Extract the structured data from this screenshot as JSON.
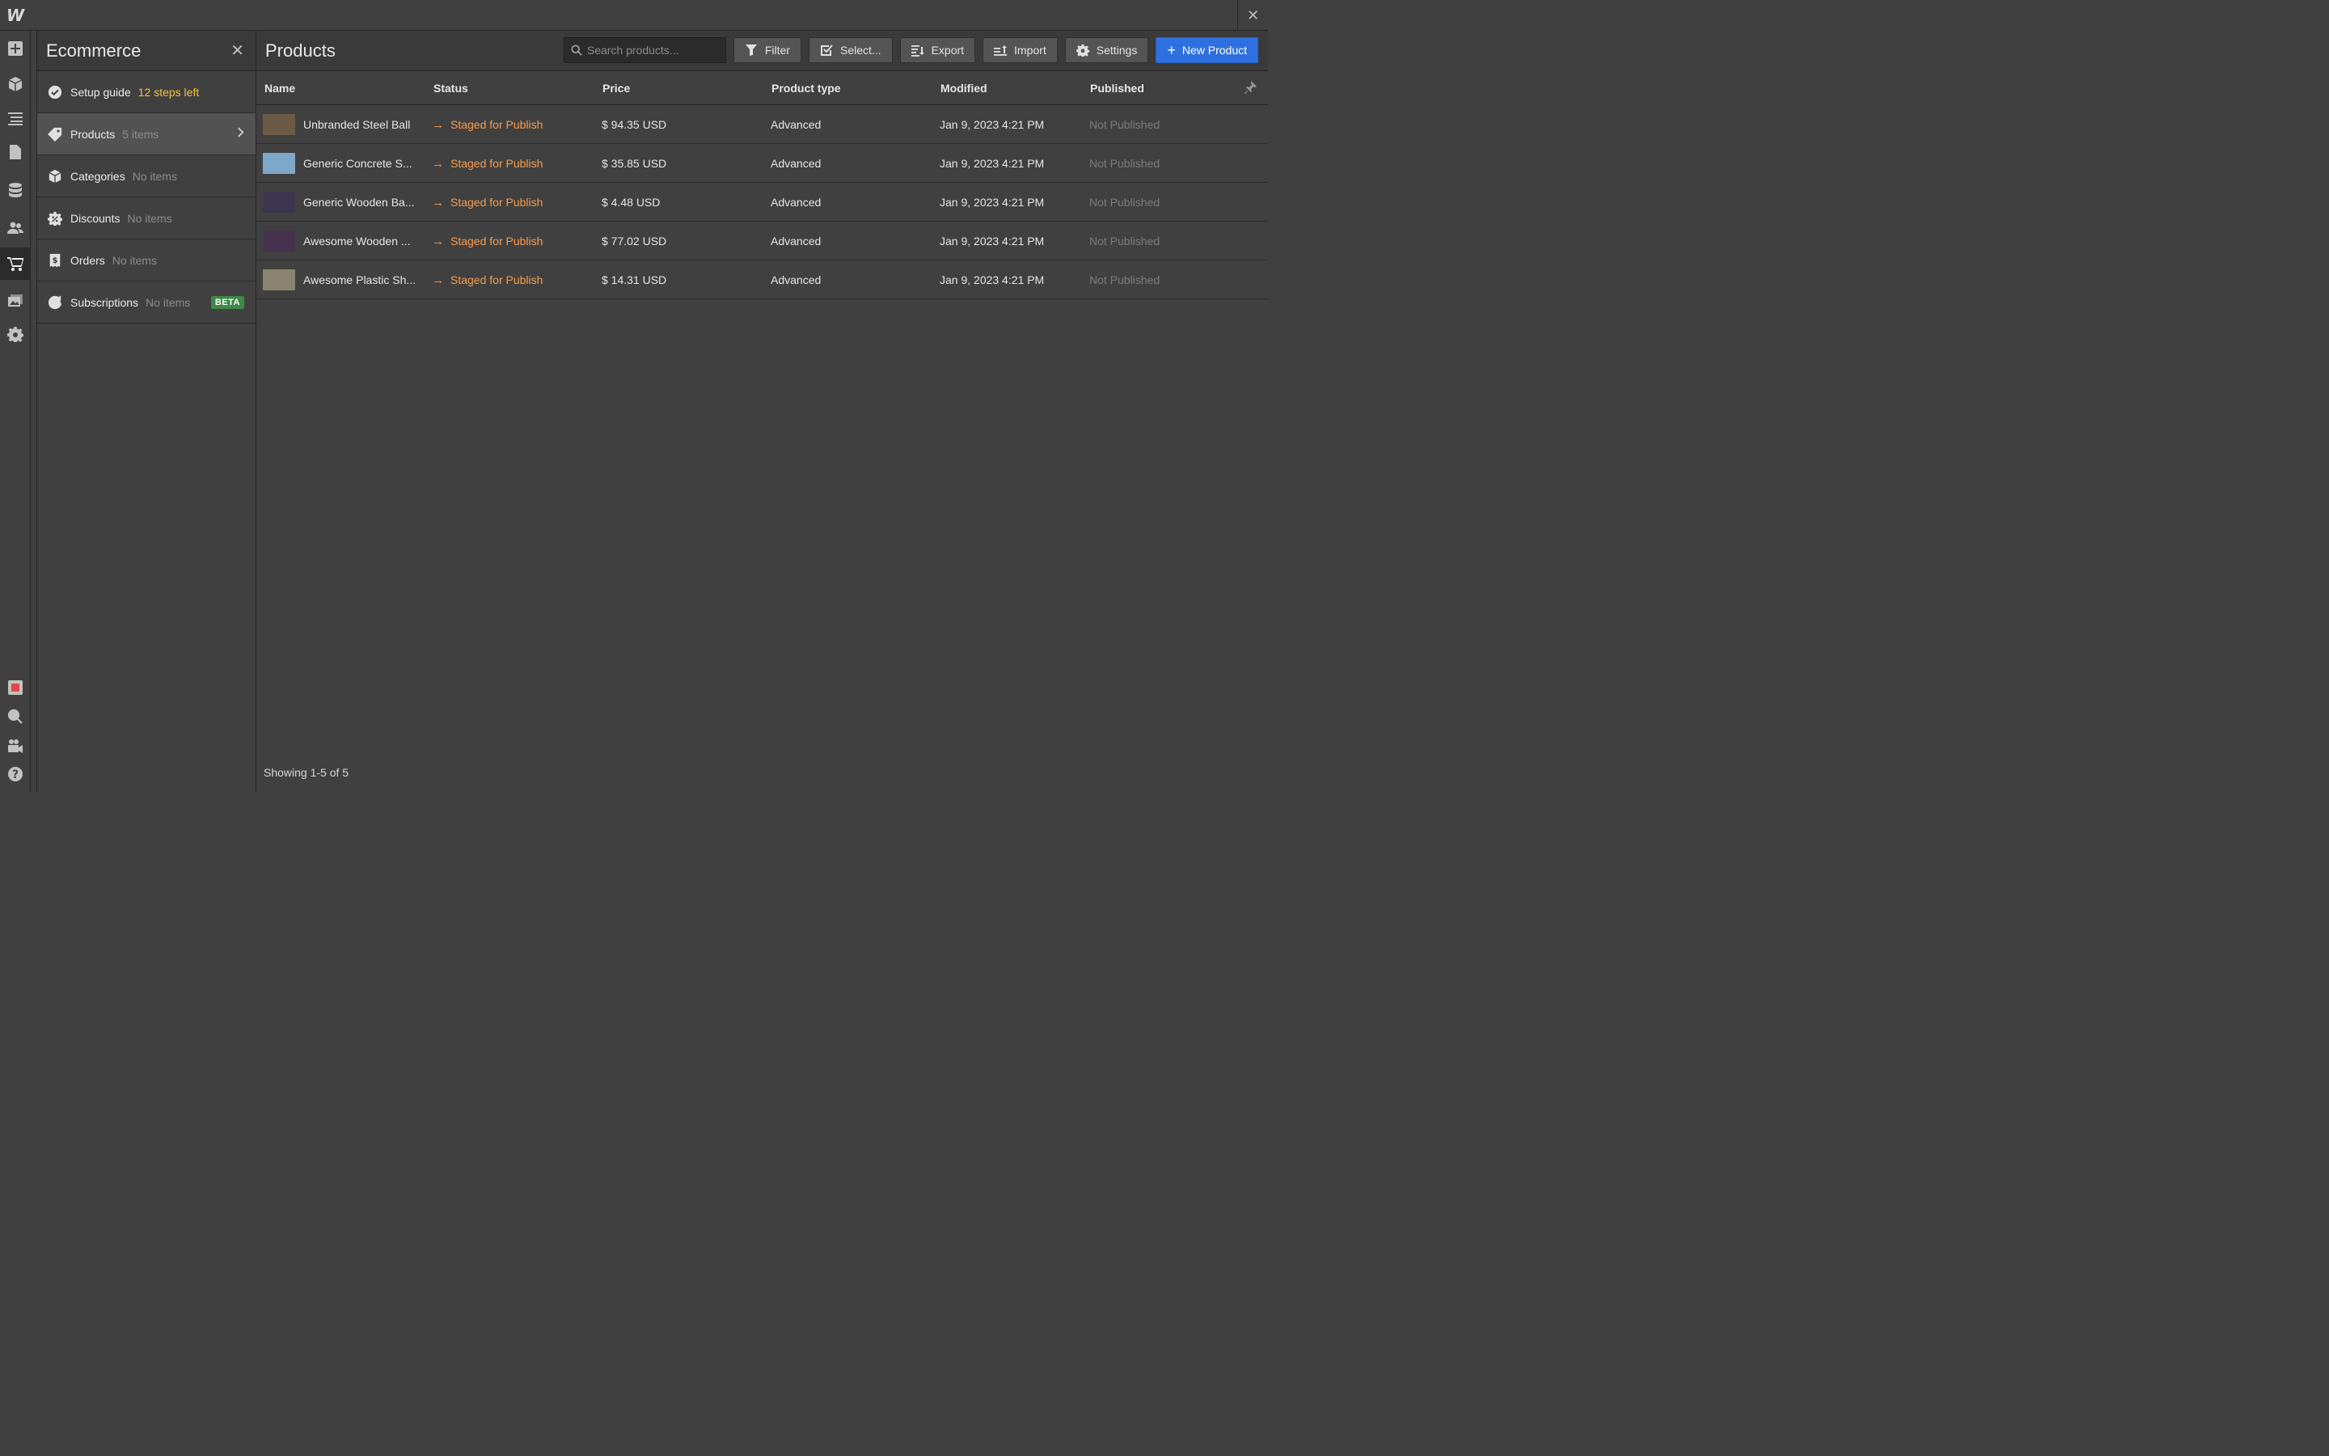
{
  "app": {
    "logo": "W",
    "close_symbol": "✕"
  },
  "rail": {
    "items": [
      {
        "name": "add-icon"
      },
      {
        "name": "box-icon"
      },
      {
        "name": "navigator-icon"
      },
      {
        "name": "pages-icon"
      },
      {
        "name": "cms-icon"
      },
      {
        "name": "users-icon"
      },
      {
        "name": "cart-icon"
      },
      {
        "name": "assets-icon"
      },
      {
        "name": "settings-icon"
      },
      {
        "name": "record-icon"
      },
      {
        "name": "search-icon"
      },
      {
        "name": "video-icon"
      },
      {
        "name": "help-icon"
      }
    ],
    "active": "cart-icon"
  },
  "panel": {
    "title": "Ecommerce",
    "items": [
      {
        "label": "Setup guide",
        "count": "12 steps left",
        "icon": "check-circle-icon"
      },
      {
        "label": "Products",
        "count": "5 items",
        "icon": "tag-icon"
      },
      {
        "label": "Categories",
        "count": "No items",
        "icon": "cube-icon"
      },
      {
        "label": "Discounts",
        "count": "No items",
        "icon": "discount-icon"
      },
      {
        "label": "Orders",
        "count": "No items",
        "icon": "dollar-icon"
      },
      {
        "label": "Subscriptions",
        "count": "No items",
        "icon": "subscription-icon",
        "badge": "BETA"
      }
    ]
  },
  "main": {
    "title": "Products",
    "search_placeholder": "Search products...",
    "toolbar": {
      "filter": "Filter",
      "select": "Select...",
      "export": "Export",
      "import": "Import",
      "settings": "Settings",
      "new_product": "New Product"
    },
    "columns": [
      "Name",
      "Status",
      "Price",
      "Product type",
      "Modified",
      "Published"
    ],
    "rows": [
      {
        "name": "Unbranded Steel Ball",
        "status": "Staged for Publish",
        "price": "$ 94.35 USD",
        "type": "Advanced",
        "modified": "Jan 9, 2023 4:21 PM",
        "published": "Not Published",
        "thumb": "#6b5a45"
      },
      {
        "name": "Generic Concrete S...",
        "status": "Staged for Publish",
        "price": "$ 35.85 USD",
        "type": "Advanced",
        "modified": "Jan 9, 2023 4:21 PM",
        "published": "Not Published",
        "thumb": "#7fa7c9"
      },
      {
        "name": "Generic Wooden Ba...",
        "status": "Staged for Publish",
        "price": "$ 4.48 USD",
        "type": "Advanced",
        "modified": "Jan 9, 2023 4:21 PM",
        "published": "Not Published",
        "thumb": "#3b3550"
      },
      {
        "name": "Awesome Wooden ...",
        "status": "Staged for Publish",
        "price": "$ 77.02 USD",
        "type": "Advanced",
        "modified": "Jan 9, 2023 4:21 PM",
        "published": "Not Published",
        "thumb": "#44324f"
      },
      {
        "name": "Awesome Plastic Sh...",
        "status": "Staged for Publish",
        "price": "$ 14.31 USD",
        "type": "Advanced",
        "modified": "Jan 9, 2023 4:21 PM",
        "published": "Not Published",
        "thumb": "#8a8470"
      }
    ],
    "footer": "Showing 1-5 of 5"
  },
  "colors": {
    "accent": "#2f70e0",
    "status_orange": "#f79d4e",
    "warning_yellow": "#f5c33b",
    "beta_green": "#3d8a46"
  }
}
